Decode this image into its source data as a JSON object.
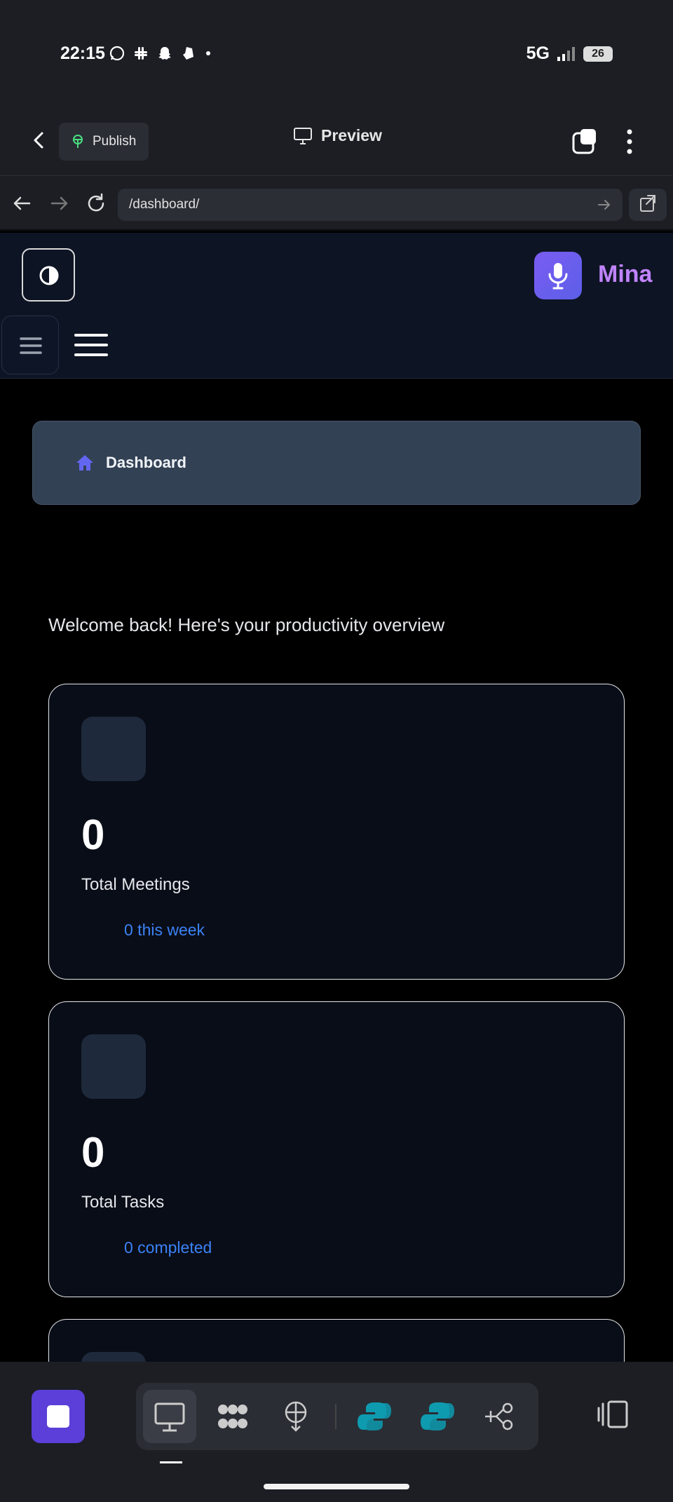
{
  "status_bar": {
    "time": "22:15",
    "network": "5G",
    "battery": "26"
  },
  "toolbar": {
    "publish_label": "Publish",
    "preview_label": "Preview"
  },
  "url_bar": {
    "url": "/dashboard/"
  },
  "header": {
    "brand": "Mina"
  },
  "breadcrumb": {
    "label": "Dashboard"
  },
  "main": {
    "welcome": "Welcome back! Here's your productivity overview",
    "cards": [
      {
        "value": "0",
        "label": "Total Meetings",
        "sub": "0 this week"
      },
      {
        "value": "0",
        "label": "Total Tasks",
        "sub": "0 completed"
      }
    ]
  },
  "colors": {
    "accent": "#3b82f6",
    "brand": "#c084fc",
    "breadcrumb_icon": "#6366f1",
    "stop_button": "#5b3fd8"
  },
  "icons": {
    "dock": [
      "desktop-icon",
      "cluster-icon",
      "deploy-icon",
      "python-icon",
      "python-icon",
      "workflow-icon"
    ],
    "side_panel": "side-panel-icon"
  }
}
